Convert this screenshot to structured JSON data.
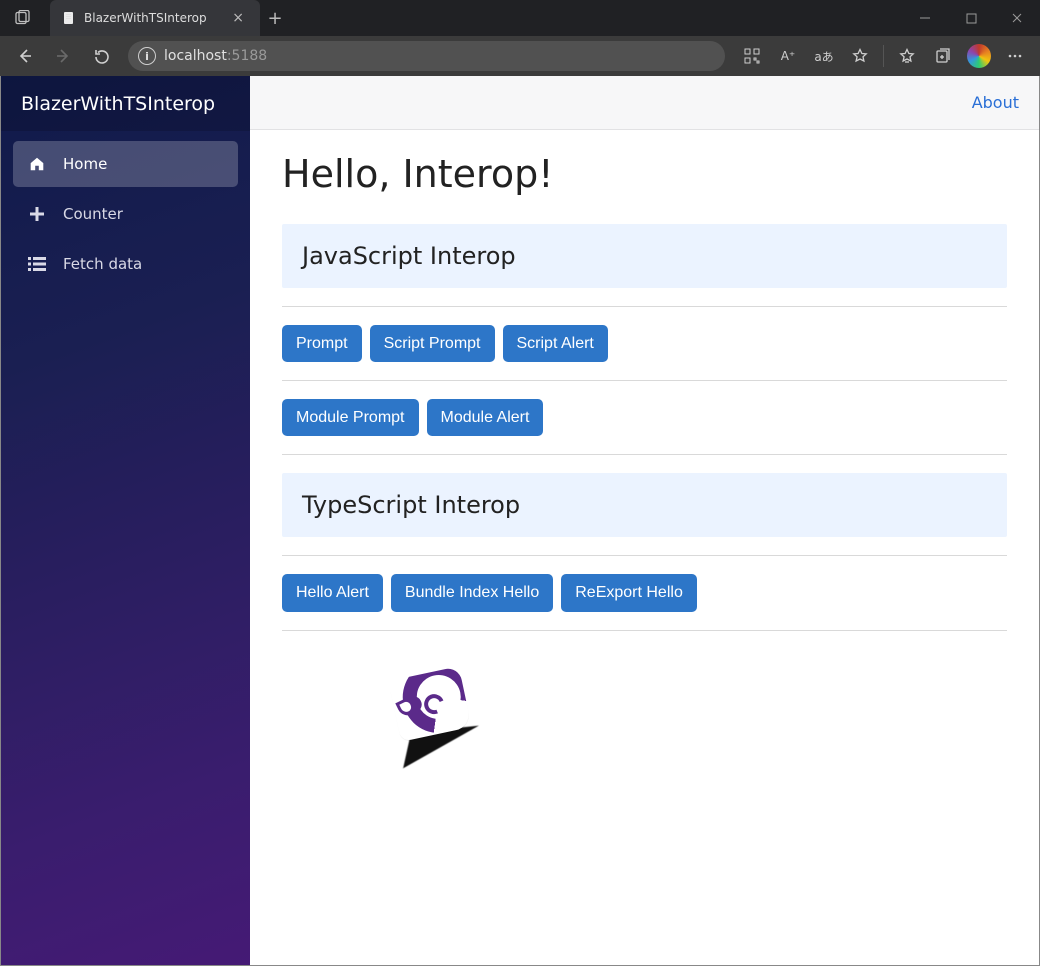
{
  "browser": {
    "tab_title": "BlazerWithTSInterop",
    "url_host": "localhost",
    "url_port": ":5188"
  },
  "sidebar": {
    "brand": "BlazerWithTSInterop",
    "items": [
      {
        "label": "Home",
        "icon": "home-icon"
      },
      {
        "label": "Counter",
        "icon": "plus-icon"
      },
      {
        "label": "Fetch data",
        "icon": "list-icon"
      }
    ]
  },
  "topbar": {
    "about_label": "About"
  },
  "main": {
    "title": "Hello, Interop!",
    "js_section_heading": "JavaScript Interop",
    "js_row1": [
      {
        "label": "Prompt"
      },
      {
        "label": "Script Prompt"
      },
      {
        "label": "Script Alert"
      }
    ],
    "js_row2": [
      {
        "label": "Module Prompt"
      },
      {
        "label": "Module Alert"
      }
    ],
    "ts_section_heading": "TypeScript Interop",
    "ts_row1": [
      {
        "label": "Hello Alert"
      },
      {
        "label": "Bundle Index Hello"
      },
      {
        "label": "ReExport Hello"
      }
    ]
  }
}
